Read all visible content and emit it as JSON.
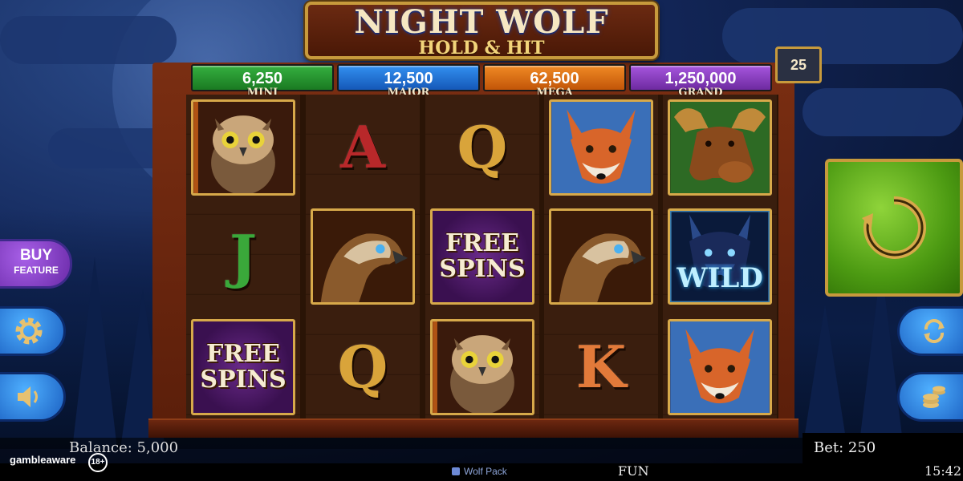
{
  "game": {
    "title_line1": "NIGHT WOLF",
    "title_line2": "HOLD & HIT",
    "lines": "25"
  },
  "jackpots": [
    {
      "label": "MINI",
      "value": "6,250",
      "color": "#1f8a2a"
    },
    {
      "label": "MAJOR",
      "value": "12,500",
      "color": "#1a6fd0"
    },
    {
      "label": "MEGA",
      "value": "62,500",
      "color": "#d96b12"
    },
    {
      "label": "GRAND",
      "value": "1,250,000",
      "color": "#8a3ac0"
    }
  ],
  "reels": [
    [
      "owl",
      "J",
      "free-spins"
    ],
    [
      "A",
      "hawk",
      "Q"
    ],
    [
      "Q",
      "free-spins",
      "owl"
    ],
    [
      "fox",
      "hawk",
      "K"
    ],
    [
      "moose",
      "wolf-wild",
      "fox"
    ]
  ],
  "symbols": {
    "free_spins_line1": "FREE",
    "free_spins_line2": "SPINS",
    "wild": "WILD"
  },
  "buttons": {
    "buy_line1": "BUY",
    "buy_line2": "FEATURE",
    "settings_icon": "gear-icon",
    "sound_icon": "speaker-icon",
    "spin_icon": "spin-arrow-icon",
    "autoplay_icon": "autoplay-icon",
    "coins_icon": "coins-icon"
  },
  "status": {
    "balance": "Balance: 5,000",
    "bet": "Bet: 250",
    "mode": "FUN",
    "time": "15:42",
    "provider": "Wolf Pack",
    "gamble_brand": "gambleaware",
    "age_badge": "18+"
  }
}
